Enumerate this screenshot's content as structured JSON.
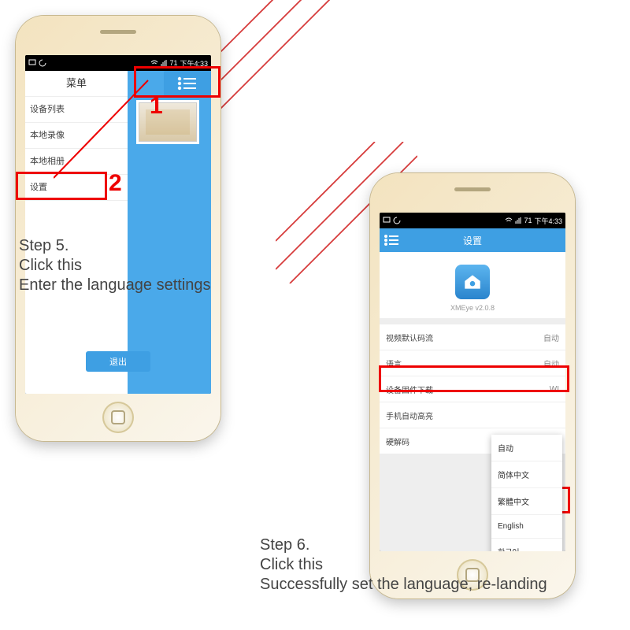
{
  "status": {
    "time": "下午4:33",
    "battery": "71"
  },
  "phone1": {
    "sidebar_header": "菜单",
    "items": [
      "设备列表",
      "本地录像",
      "本地相册",
      "设置"
    ],
    "exit": "退出"
  },
  "phone2": {
    "title": "设置",
    "app_name": "XMEye v2.0.8",
    "rows": [
      {
        "label": "视频默认码流",
        "value": "自动"
      },
      {
        "label": "语言",
        "value": "自动"
      },
      {
        "label": "设备固件下载",
        "value": "WI"
      },
      {
        "label": "手机自动高亮",
        "value": ""
      },
      {
        "label": "硬解码",
        "value": ""
      }
    ],
    "dropdown": [
      "自动",
      "简体中文",
      "繁體中文",
      "English",
      "한국어"
    ]
  },
  "annotations": {
    "n1": "1",
    "n2": "2",
    "step5_title": "Step 5.",
    "step5_l2": "Click this",
    "step5_l3": "Enter the language settings",
    "step6_title": "Step 6.",
    "step6_l2": "Click this",
    "step6_l3": "Successfully set the language, re-landing"
  }
}
